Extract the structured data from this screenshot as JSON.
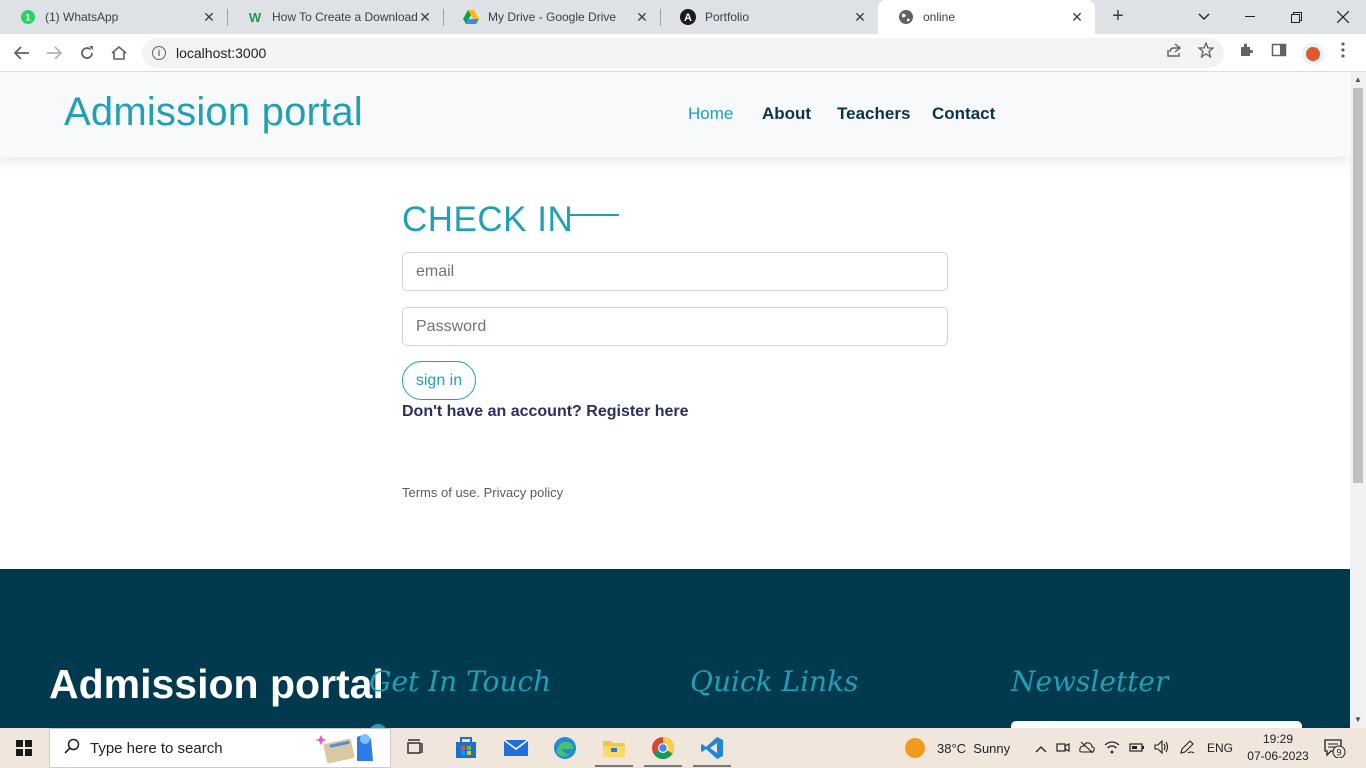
{
  "browser": {
    "tabs": [
      {
        "title": "(1) WhatsApp",
        "icon": "whatsapp-icon",
        "badge": "1"
      },
      {
        "title": "How To Create a Download Link",
        "icon": "w-logo-icon"
      },
      {
        "title": "My Drive - Google Drive",
        "icon": "google-drive-icon"
      },
      {
        "title": "Portfolio",
        "icon": "angular-icon"
      },
      {
        "title": "online",
        "icon": "globe-icon",
        "active": true
      }
    ],
    "url": "localhost:3000"
  },
  "site": {
    "brand": "Admission portal",
    "nav": [
      "Home",
      "About",
      "Teachers",
      "Contact"
    ],
    "active_nav": "Home"
  },
  "checkin": {
    "title": "CHECK IN",
    "email_placeholder": "email",
    "password_placeholder": "Password",
    "signin_label": "sign in",
    "register_text": "Don't have an account? Register here",
    "terms_text": "Terms of use. Privacy policy"
  },
  "footer": {
    "brand": "Admission portal",
    "headings": [
      "Get In Touch",
      "Quick Links",
      "Newsletter"
    ]
  },
  "taskbar": {
    "search_placeholder": "Type here to search",
    "weather": "38°C  Sunny",
    "language": "ENG",
    "time": "19:29",
    "date": "07-06-2023",
    "notifications": "9"
  },
  "colors": {
    "accent": "#1fa0b5",
    "footer_bg": "#01394f",
    "nav_text": "#0b3546"
  }
}
